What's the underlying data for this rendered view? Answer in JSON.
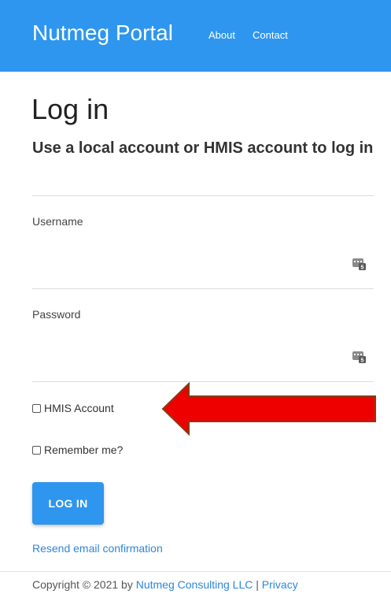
{
  "header": {
    "brand": "Nutmeg Portal",
    "nav": {
      "about": "About",
      "contact": "Contact"
    }
  },
  "colors": {
    "primary": "#2e96ee",
    "link": "#2e86de",
    "annotation_arrow": "#ee0000"
  },
  "main": {
    "title": "Log in",
    "subtitle": "Use a local account or HMIS account to log in",
    "username": {
      "label": "Username",
      "value": "",
      "placeholder": "",
      "icon": "keyboard-icon"
    },
    "password": {
      "label": "Password",
      "value": "",
      "placeholder": "",
      "icon": "keyboard-icon"
    },
    "hmis_account": {
      "label": "HMIS Account",
      "checked": false
    },
    "remember_me": {
      "label": "Remember me?",
      "checked": false
    },
    "login_button": "LOG IN",
    "resend_link": "Resend email confirmation"
  },
  "footer": {
    "copyright": "Copyright © 2021 by ",
    "company_link": "Nutmeg Consulting LLC",
    "separator": " | ",
    "privacy_link": "Privacy"
  }
}
